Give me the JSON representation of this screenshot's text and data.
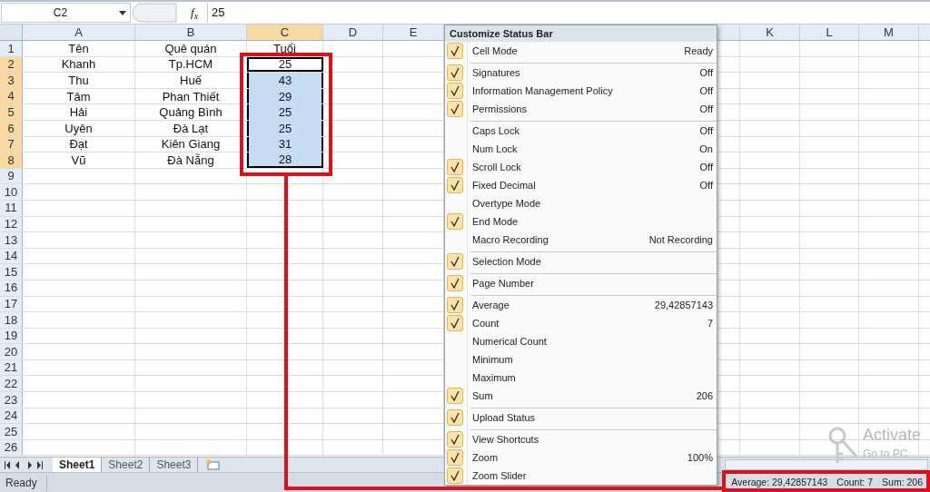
{
  "formula_bar": {
    "name_box": "C2",
    "function_label": "f$_{x}$",
    "value": "25"
  },
  "columns": [
    {
      "label": "A",
      "selected": false
    },
    {
      "label": "B",
      "selected": false
    },
    {
      "label": "C",
      "selected": true
    },
    {
      "label": "D",
      "selected": false
    },
    {
      "label": "E",
      "selected": false
    },
    {
      "label": "K",
      "selected": false
    },
    {
      "label": "L",
      "selected": false
    },
    {
      "label": "M",
      "selected": false
    }
  ],
  "rows": [
    {
      "number": "1",
      "selected": false,
      "active": false,
      "cells": [
        "Tên",
        "Quê quán",
        "Tuổi"
      ]
    },
    {
      "number": "2",
      "selected": true,
      "active": true,
      "cells": [
        "Khanh",
        "Tp.HCM",
        "25"
      ]
    },
    {
      "number": "3",
      "selected": true,
      "active": false,
      "cells": [
        "Thu",
        "Huế",
        "43"
      ]
    },
    {
      "number": "4",
      "selected": true,
      "active": false,
      "cells": [
        "Tâm",
        "Phan Thiết",
        "29"
      ]
    },
    {
      "number": "5",
      "selected": true,
      "active": false,
      "cells": [
        "Hải",
        "Quảng Bình",
        "25"
      ]
    },
    {
      "number": "6",
      "selected": true,
      "active": false,
      "cells": [
        "Uyên",
        "Đà Lạt",
        "25"
      ]
    },
    {
      "number": "7",
      "selected": true,
      "active": false,
      "cells": [
        "Đạt",
        "Kiên Giang",
        "31"
      ]
    },
    {
      "number": "8",
      "selected": true,
      "active": false,
      "cells": [
        "Vũ",
        "Đà Nẵng",
        "28"
      ]
    },
    {
      "number": "9",
      "selected": false,
      "active": false
    },
    {
      "number": "10",
      "selected": false,
      "active": false
    },
    {
      "number": "11",
      "selected": false,
      "active": false
    },
    {
      "number": "12",
      "selected": false,
      "active": false
    },
    {
      "number": "13",
      "selected": false,
      "active": false
    },
    {
      "number": "14",
      "selected": false,
      "active": false
    },
    {
      "number": "15",
      "selected": false,
      "active": false
    },
    {
      "number": "16",
      "selected": false,
      "active": false
    },
    {
      "number": "17",
      "selected": false,
      "active": false
    },
    {
      "number": "18",
      "selected": false,
      "active": false
    },
    {
      "number": "19",
      "selected": false,
      "active": false
    },
    {
      "number": "20",
      "selected": false,
      "active": false
    },
    {
      "number": "21",
      "selected": false,
      "active": false
    },
    {
      "number": "22",
      "selected": false,
      "active": false
    },
    {
      "number": "23",
      "selected": false,
      "active": false
    },
    {
      "number": "24",
      "selected": false,
      "active": false
    },
    {
      "number": "25",
      "selected": false,
      "active": false
    },
    {
      "number": "26",
      "selected": false,
      "active": false
    }
  ],
  "context_menu": {
    "title": "Customize Status Bar",
    "items": [
      {
        "label": "Cell Mode",
        "value": "Ready",
        "checked": true,
        "separator_after": true
      },
      {
        "label": "Signatures",
        "value": "Off",
        "checked": true,
        "separator_after": false
      },
      {
        "label": "Information Management Policy",
        "value": "Off",
        "checked": true,
        "separator_after": false
      },
      {
        "label": "Permissions",
        "value": "Off",
        "checked": true,
        "separator_after": true
      },
      {
        "label": "Caps Lock",
        "value": "Off",
        "checked": false,
        "separator_after": false
      },
      {
        "label": "Num Lock",
        "value": "On",
        "checked": false,
        "separator_after": false
      },
      {
        "label": "Scroll Lock",
        "value": "Off",
        "checked": true,
        "separator_after": false
      },
      {
        "label": "Fixed Decimal",
        "value": "Off",
        "checked": true,
        "separator_after": false
      },
      {
        "label": "Overtype Mode",
        "checked": false,
        "separator_after": false
      },
      {
        "label": "End Mode",
        "checked": true,
        "separator_after": false
      },
      {
        "label": "Macro Recording",
        "value": "Not Recording",
        "checked": false,
        "separator_after": true
      },
      {
        "label": "Selection Mode",
        "checked": true,
        "separator_after": true
      },
      {
        "label": "Page Number",
        "checked": true,
        "separator_after": true
      },
      {
        "label": "Average",
        "value": "29,42857143",
        "checked": true,
        "separator_after": false
      },
      {
        "label": "Count",
        "value": "7",
        "checked": true,
        "separator_after": false
      },
      {
        "label": "Numerical Count",
        "checked": false,
        "separator_after": false
      },
      {
        "label": "Minimum",
        "checked": false,
        "separator_after": false
      },
      {
        "label": "Maximum",
        "checked": false,
        "separator_after": false
      },
      {
        "label": "Sum",
        "value": "206",
        "checked": true,
        "separator_after": true
      },
      {
        "label": "Upload Status",
        "checked": true,
        "separator_after": true
      },
      {
        "label": "View Shortcuts",
        "checked": true,
        "separator_after": false
      },
      {
        "label": "Zoom",
        "value": "100%",
        "checked": true,
        "separator_after": false
      },
      {
        "label": "Zoom Slider",
        "checked": true,
        "separator_after": false
      }
    ]
  },
  "sheet_tabs": [
    {
      "label": "Sheet1",
      "selected": true
    },
    {
      "label": "Sheet2",
      "selected": false
    },
    {
      "label": "Sheet3",
      "selected": false
    }
  ],
  "activation_notice": {
    "title": "Activate",
    "subtitle": "Go to PC"
  },
  "status_bar": {
    "mode": "Ready",
    "summary": [
      "Average: 29,42857143",
      "Count: 7",
      "Sum: 206"
    ]
  }
}
